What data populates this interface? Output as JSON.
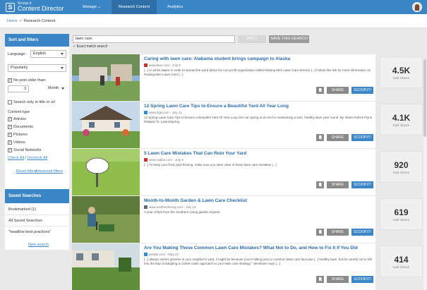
{
  "app": {
    "logo_small": "Scoop.it",
    "logo_big": "Content Director"
  },
  "nav": {
    "manage": "Manage ⌄",
    "research": "Research Content",
    "analytics": "Analytics"
  },
  "breadcrumb": {
    "home": "Home",
    "separator": ">",
    "current": "Research Content"
  },
  "sidebar": {
    "header": "Sort and filters",
    "language_label": "Language:",
    "language_value": "English",
    "sort_value": "Popularity",
    "no_post_older_label": "No post older than:",
    "age_value": "3",
    "age_unit": "Month",
    "search_title_url_label": "Search only in title or url",
    "content_type_label": "Content type",
    "types": [
      "Articles",
      "Documents",
      "Pictures",
      "Videos",
      "Social Networks"
    ],
    "check_all": "Check All",
    "slash": "/",
    "uncheck_all": "Uncheck All",
    "reset_filters": "Reset filters",
    "advanced_filters": "Advanced filters"
  },
  "saved": {
    "header": "Saved Searches",
    "bookmarked": "Bookmarked (1)",
    "all_saved": "All Saved Searches",
    "headline": "\"headline best practices\"",
    "new_search": "New search"
  },
  "search": {
    "query": "lawn care",
    "apply_label": "APPLY",
    "save_label": "SAVE THIS SEARCH",
    "exact_match": "Exact match search"
  },
  "buttons": {
    "share": "SHARE",
    "scoop": "SCOOP.IT!"
  },
  "shares_label": "total shares",
  "results": [
    {
      "title": "Caring with lawn care: Alabama student brings campaign to Alaska",
      "source": "www.ktuu.com - July 8",
      "snippet": "[...] in all 50 states in order to spread the word about his non-profit organization called Raising Men Lawn Care Service [...] Follow this link for more information on Raising Men Lawn Care [...]",
      "shares": "4.5K"
    },
    {
      "title": "12 Spring Lawn Care Tips to Ensure a Beautiful Yard All Year Long",
      "source": "www.hgtv.com - July 11",
      "snippet": "12 Spring Lawn Care Tips to Ensure a Beautiful Yard All Year Long Get our spring to-do list for maintaining a lush, healthy lawn year-round. By: Brian Patrick Flynn Related To: LawnsSpring",
      "shares": "4.1K"
    },
    {
      "title": "5 Lawn Care Mistakes That Can Ruin Your Yard",
      "source": "www.realtor.com - July 9",
      "snippet": "[...] To keep your front yard thriving, make sure you steer clear of these lawn care mistakes [...]",
      "shares": "920"
    },
    {
      "title": "Month-to-Month Garden & Lawn Care Checklist",
      "source": "www.southernliving.com - July 13",
      "snippet": "A year of tips from the Southern Living garden experts.",
      "shares": "619"
    },
    {
      "title": "Are You Making These Common Lawn Care Mistakes? What Not to Do, and How to Fix It If You Did",
      "source": "people.com - May 22",
      "snippet": "[...] always seems greener in your neighbor's yard, it might be because you're falling prey to common lawn care faux-pas [...] healthy lawn, but be careful not to fall into the trap of adopting a cookie-cutter approach to your lawn care strategy,\" Henriksen says [...]",
      "shares": "414"
    }
  ]
}
